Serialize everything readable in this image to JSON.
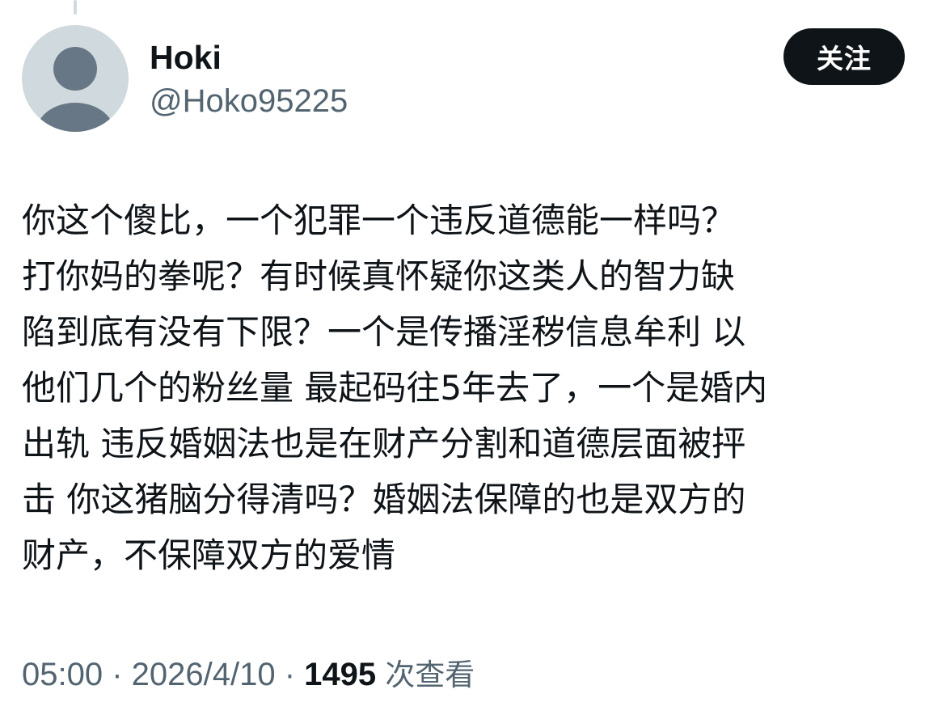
{
  "user": {
    "display_name": "Hoki",
    "handle": "@Hoko95225"
  },
  "follow_button": {
    "label": "关注"
  },
  "tweet": {
    "text": "你这个傻比，一个犯罪一个违反道德能一样吗？\n打你妈的拳呢？有时候真怀疑你这类人的智力缺\n陷到底有没有下限？一个是传播淫秽信息牟利 以\n他们几个的粉丝量 最起码往5年去了，一个是婚内\n出轨 违反婚姻法也是在财产分割和道德层面被抨\n击 你这猪脑分得清吗？婚姻法保障的也是双方的\n财产，不保障双方的爱情"
  },
  "meta": {
    "time": "05:00",
    "separator": " · ",
    "date": "2026/4/10",
    "views_count": "1495",
    "views_label": "次查看"
  },
  "icons": {
    "avatar": "default-avatar-icon"
  },
  "colors": {
    "text_primary": "#0f1419",
    "text_secondary": "#536471",
    "avatar_bg": "#cfd9de",
    "avatar_figure": "#677785",
    "button_bg": "#0f1419",
    "button_text": "#ffffff"
  }
}
